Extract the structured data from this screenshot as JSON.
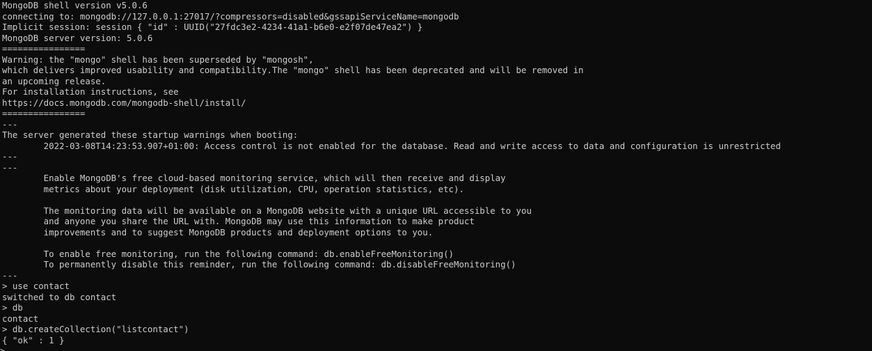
{
  "theme": {
    "background": "#0c0c0c",
    "foreground": "#cccccc"
  },
  "lines": [
    "MongoDB shell version v5.0.6",
    "connecting to: mongodb://127.0.0.1:27017/?compressors=disabled&gssapiServiceName=mongodb",
    "Implicit session: session { \"id\" : UUID(\"27fdc3e2-4234-41a1-b6e0-e2f07de47ea2\") }",
    "MongoDB server version: 5.0.6",
    "================",
    "Warning: the \"mongo\" shell has been superseded by \"mongosh\",",
    "which delivers improved usability and compatibility.The \"mongo\" shell has been deprecated and will be removed in",
    "an upcoming release.",
    "For installation instructions, see",
    "https://docs.mongodb.com/mongodb-shell/install/",
    "================",
    "---",
    "The server generated these startup warnings when booting:",
    "        2022-03-08T14:23:53.907+01:00: Access control is not enabled for the database. Read and write access to data and configuration is unrestricted",
    "---",
    "---",
    "        Enable MongoDB's free cloud-based monitoring service, which will then receive and display",
    "        metrics about your deployment (disk utilization, CPU, operation statistics, etc).",
    "",
    "        The monitoring data will be available on a MongoDB website with a unique URL accessible to you",
    "        and anyone you share the URL with. MongoDB may use this information to make product",
    "        improvements and to suggest MongoDB products and deployment options to you.",
    "",
    "        To enable free monitoring, run the following command: db.enableFreeMonitoring()",
    "        To permanently disable this reminder, run the following command: db.disableFreeMonitoring()",
    "---",
    "> use contact",
    "switched to db contact",
    "> db",
    "contact",
    "> db.createCollection(\"listcontact\")",
    "{ \"ok\" : 1 }"
  ],
  "prompt": ">"
}
